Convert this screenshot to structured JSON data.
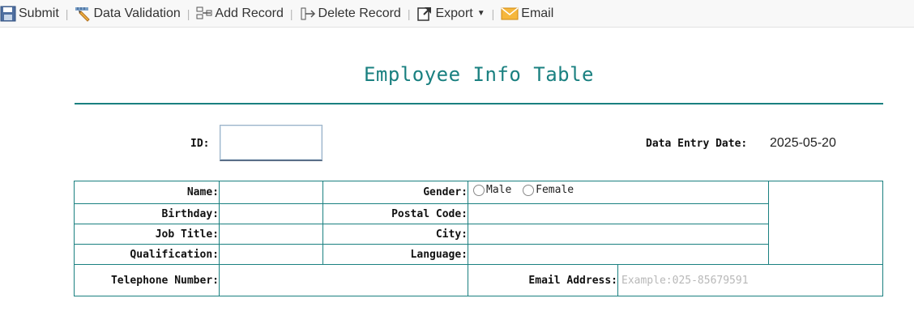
{
  "toolbar": {
    "submit": "Submit",
    "data_validation": "Data Validation",
    "add_record": "Add Record",
    "delete_record": "Delete Record",
    "export": "Export",
    "email": "Email",
    "separator": "|"
  },
  "form": {
    "title": "Employee Info Table",
    "id_label": "ID:",
    "id_value": "",
    "entry_date_label": "Data Entry Date:",
    "entry_date_value": "2025-05-20",
    "name_label": "Name:",
    "gender_label": "Gender:",
    "gender_options": [
      "Male",
      "Female"
    ],
    "birthday_label": "Birthday:",
    "postal_code_label": "Postal Code:",
    "job_title_label": "Job Title:",
    "city_label": "City:",
    "qualification_label": "Qualification:",
    "language_label": "Language:",
    "telephone_label": "Telephone Number:",
    "email_label": "Email Address:",
    "email_placeholder": "Example:025-85679591"
  },
  "colors": {
    "accent": "#1a8080",
    "toolbar_bg": "#f8f8f8"
  },
  "icons": {
    "submit": "floppy-disk-icon",
    "data_validation": "ruler-pencil-icon",
    "add_record": "add-record-icon",
    "delete_record": "delete-record-icon",
    "export": "export-icon",
    "email": "envelope-icon"
  }
}
